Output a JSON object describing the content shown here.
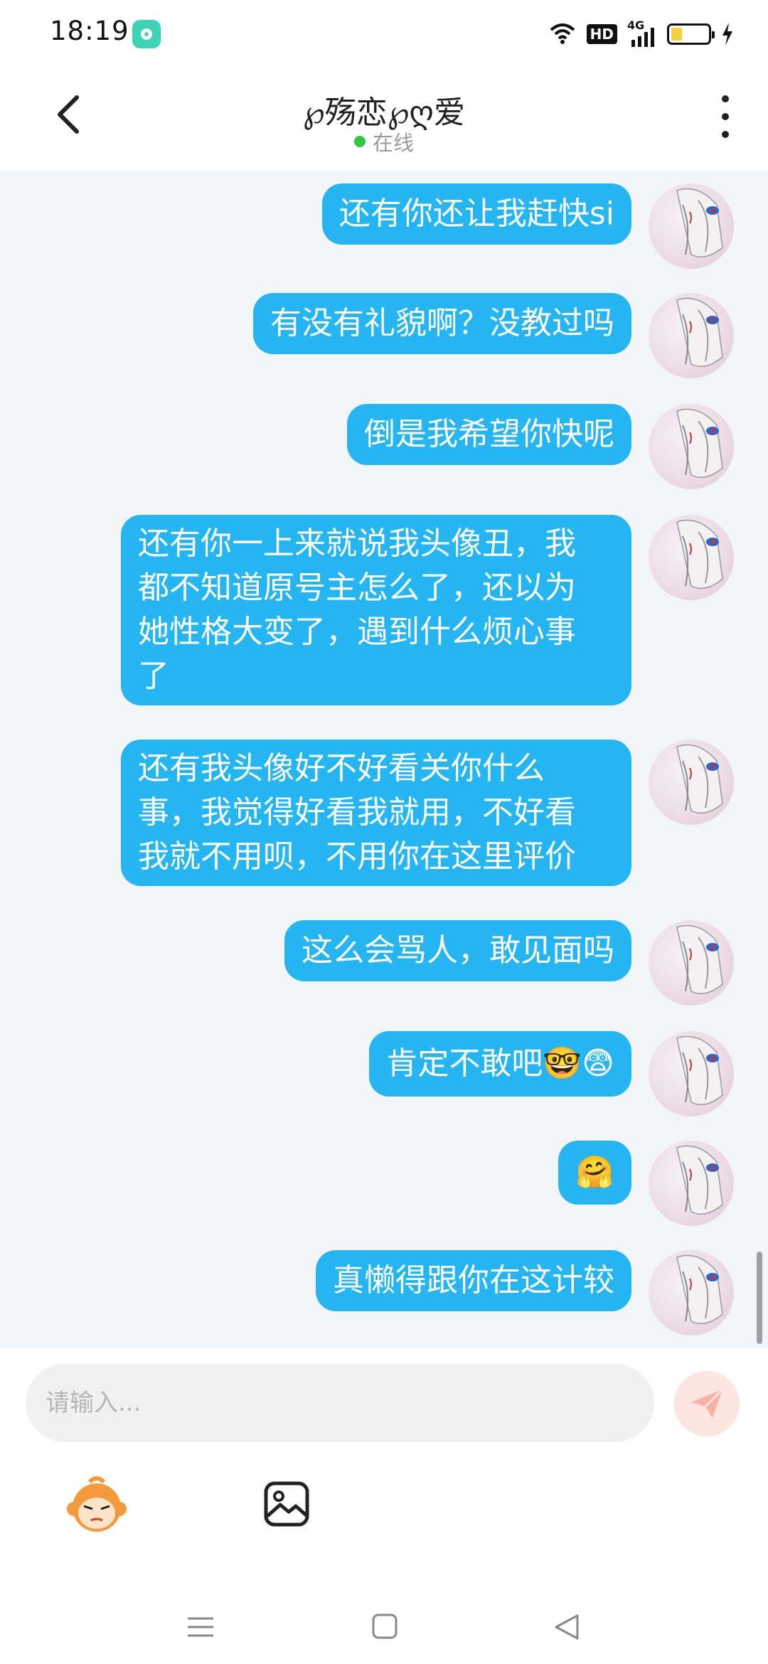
{
  "status_bar": {
    "time": "18:19",
    "hd": "HD",
    "network": "4G"
  },
  "header": {
    "contact_name": "℘殇恋℘ღ爱",
    "status": "在线",
    "icons": [
      "back-arrow-icon",
      "more-vertical-icon"
    ]
  },
  "messages": [
    {
      "text": "还有你还让我赶快si"
    },
    {
      "text": "有没有礼貌啊？没教过吗"
    },
    {
      "text": "倒是我希望你快呢"
    },
    {
      "text": "还有你一上来就说我头像丑，我\n都不知道原号主怎么了，还以为\n她性格大变了，遇到什么烦心事\n了"
    },
    {
      "text": "还有我头像好不好看关你什么\n事，我觉得好看我就用，不好看\n我就不用呗，不用你在这里评价"
    },
    {
      "text": "这么会骂人，敢见面吗"
    },
    {
      "text": "肯定不敢吧🤓😨"
    },
    {
      "text": "🤗"
    },
    {
      "text": "真懒得跟你在这计较"
    }
  ],
  "input": {
    "placeholder": "请输入..."
  },
  "toolbar": {
    "icons": [
      "monkey-emoji-icon",
      "image-icon",
      "send-icon"
    ]
  },
  "colors": {
    "bubble": "#26b5f3",
    "chat_bg": "#f3f6f9",
    "online": "#2ec844",
    "send_bg": "#fde5e2",
    "send_icon": "#f7b2a8"
  }
}
